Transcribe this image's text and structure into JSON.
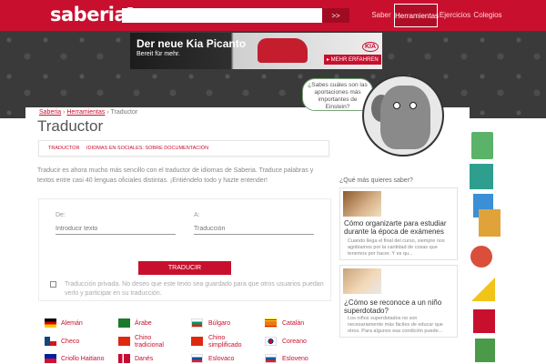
{
  "header": {
    "logo": "saberia",
    "search_placeholder": "",
    "search_button": ">>",
    "nav": [
      "Saber",
      "Herramientas",
      "Ejercicios",
      "Colegios"
    ],
    "active_nav": "Herramientas"
  },
  "ad": {
    "title": "Der neue Kia Picanto",
    "subtitle": "Bereit für mehr.",
    "cta": "▸ MEHR ERFAHREN",
    "brand": "KIA"
  },
  "breadcrumb": {
    "items": [
      "Saberia",
      "Herramientas",
      "Traductor"
    ],
    "separator": " › "
  },
  "page_title": "Traductor",
  "tabs": [
    "TRADUCTOR",
    "IDIOMAS EN SOCIALES: SOBRE DOCUMENTACIÓN"
  ],
  "intro": "Traducir es ahora mucho más sencillo con el traductor de idiomas de Saberia. Traduce palabras y textos entre casi 40 lenguas oficiales distintas. ¡Entiéndelo todo y hazte entender!",
  "translator": {
    "from_label": "De:",
    "from_placeholder": "Introducir texto",
    "to_label": "A:",
    "to_placeholder": "Traducción",
    "button": "TRADUCIR",
    "privacy_text": "Traducción privada. No deseo que este texto sea guardado para que otros usuarios puedan verlo y participar en su traducción."
  },
  "languages": [
    {
      "name": "Alemán",
      "flag": "germany-flag"
    },
    {
      "name": "Árabe",
      "flag": "arabic-flag"
    },
    {
      "name": "Búlgaro",
      "flag": "bulgaria-flag"
    },
    {
      "name": "Catalán",
      "flag": "catalonia-flag"
    },
    {
      "name": "Checo",
      "flag": "czech-flag"
    },
    {
      "name": "Chino tradicional",
      "flag": "china-flag"
    },
    {
      "name": "Chino simplificado",
      "flag": "china-flag"
    },
    {
      "name": "Coreano",
      "flag": "korea-flag"
    },
    {
      "name": "Criollo Haitiano",
      "flag": "haiti-flag"
    },
    {
      "name": "Danés",
      "flag": "denmark-flag"
    },
    {
      "name": "Eslovaco",
      "flag": "slovakia-flag"
    },
    {
      "name": "Esloveno",
      "flag": "slovenia-flag"
    }
  ],
  "sidebar": {
    "bubble": "¿Sabes cuáles son las aportaciones más importantes de Einstein?",
    "heading": "¿Qué más quieres saber?",
    "cards": [
      {
        "title": "Cómo organizarte para estudiar durante la época de exámenes",
        "text": "Cuando llega el final del curso, siempre nos agobiamos por la cantidad de cosas que tenemos por hacer. Y es qu..."
      },
      {
        "title": "¿Cómo se reconoce a un niño superdotado?",
        "text": "Los niños superdotados no son necesariamente más fáciles de educar que otros. Para algunos esa condición puede..."
      }
    ]
  },
  "colors": {
    "brand": "#c8102e",
    "pattern_bg": "#3a3a3a"
  }
}
